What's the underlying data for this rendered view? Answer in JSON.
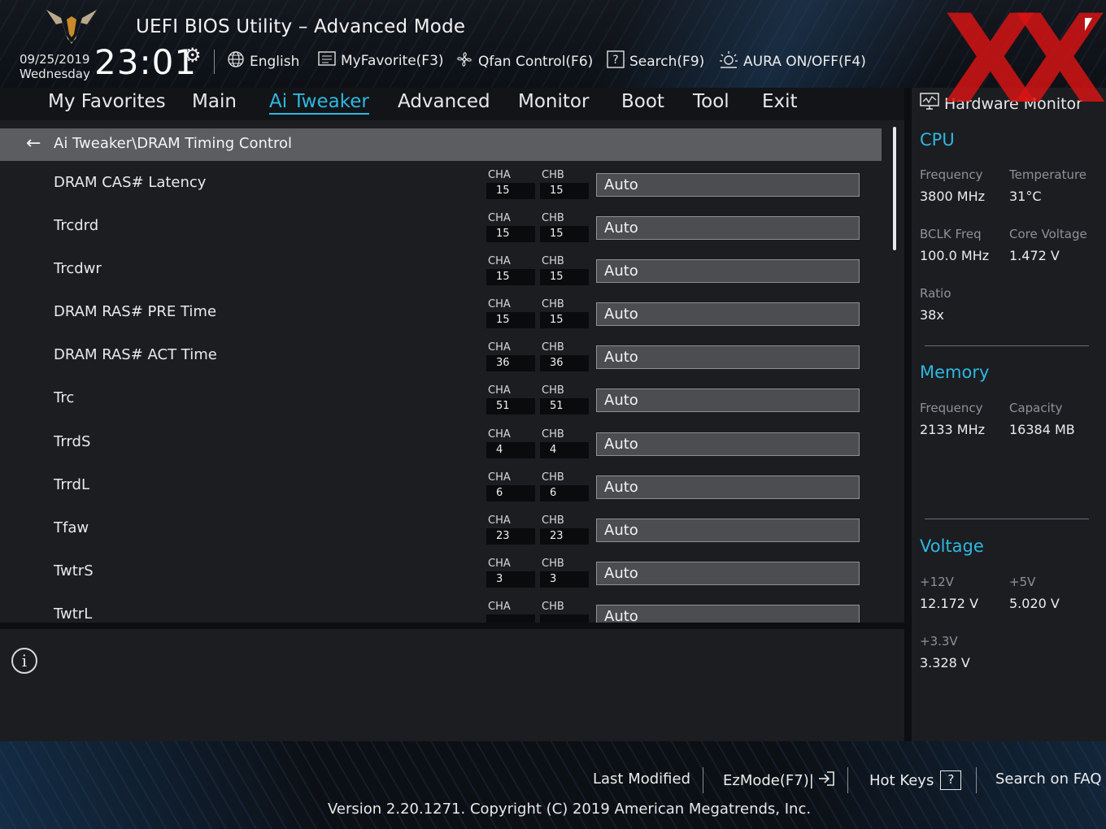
{
  "header": {
    "title": "UEFI BIOS Utility – Advanced Mode",
    "date": "09/25/2019",
    "weekday": "Wednesday",
    "time": "23:01",
    "toolbar": [
      {
        "label": "English",
        "icon": "globe-icon"
      },
      {
        "label": "MyFavorite(F3)",
        "icon": "favorite-list-icon"
      },
      {
        "label": "Qfan Control(F6)",
        "icon": "fan-icon"
      },
      {
        "label": "Search(F9)",
        "icon": "search-help-icon"
      },
      {
        "label": "AURA ON/OFF(F4)",
        "icon": "aura-light-icon"
      }
    ],
    "watermark": "XX"
  },
  "nav": {
    "tabs": [
      "My Favorites",
      "Main",
      "Ai Tweaker",
      "Advanced",
      "Monitor",
      "Boot",
      "Tool",
      "Exit"
    ],
    "active": "Ai Tweaker"
  },
  "breadcrumb": "Ai Tweaker\\DRAM Timing Control",
  "channel_labels": {
    "a": "CHA",
    "b": "CHB"
  },
  "settings": [
    {
      "label": "DRAM CAS# Latency",
      "cha": "15",
      "chb": "15",
      "value": "Auto"
    },
    {
      "label": "Trcdrd",
      "cha": "15",
      "chb": "15",
      "value": "Auto"
    },
    {
      "label": "Trcdwr",
      "cha": "15",
      "chb": "15",
      "value": "Auto"
    },
    {
      "label": "DRAM RAS# PRE Time",
      "cha": "15",
      "chb": "15",
      "value": "Auto"
    },
    {
      "label": "DRAM RAS# ACT Time",
      "cha": "36",
      "chb": "36",
      "value": "Auto"
    },
    {
      "label": "Trc",
      "cha": "51",
      "chb": "51",
      "value": "Auto"
    },
    {
      "label": "TrrdS",
      "cha": "4",
      "chb": "4",
      "value": "Auto"
    },
    {
      "label": "TrrdL",
      "cha": "6",
      "chb": "6",
      "value": "Auto"
    },
    {
      "label": "Tfaw",
      "cha": "23",
      "chb": "23",
      "value": "Auto"
    },
    {
      "label": "TwtrS",
      "cha": "3",
      "chb": "3",
      "value": "Auto"
    },
    {
      "label": "TwtrL",
      "cha": "",
      "chb": "",
      "value": "Auto"
    }
  ],
  "hw_monitor": {
    "title": "Hardware Monitor",
    "cpu": {
      "heading": "CPU",
      "frequency_label": "Frequency",
      "frequency": "3800 MHz",
      "temperature_label": "Temperature",
      "temperature": "31°C",
      "bclk_label": "BCLK Freq",
      "bclk": "100.0 MHz",
      "core_voltage_label": "Core Voltage",
      "core_voltage": "1.472 V",
      "ratio_label": "Ratio",
      "ratio": "38x"
    },
    "memory": {
      "heading": "Memory",
      "frequency_label": "Frequency",
      "frequency": "2133 MHz",
      "capacity_label": "Capacity",
      "capacity": "16384 MB"
    },
    "voltage": {
      "heading": "Voltage",
      "v12_label": "+12V",
      "v12": "12.172 V",
      "v5_label": "+5V",
      "v5": "5.020 V",
      "v33_label": "+3.3V",
      "v33": "3.328 V"
    }
  },
  "footer": {
    "last_modified": "Last Modified",
    "ezmode": "EzMode(F7)|",
    "hot_keys": "Hot Keys",
    "search_faq": "Search on FAQ",
    "version": "Version 2.20.1271. Copyright (C) 2019 American Megatrends, Inc."
  },
  "colors": {
    "accent": "#2fb7e0",
    "watermark": "#dc1414"
  }
}
